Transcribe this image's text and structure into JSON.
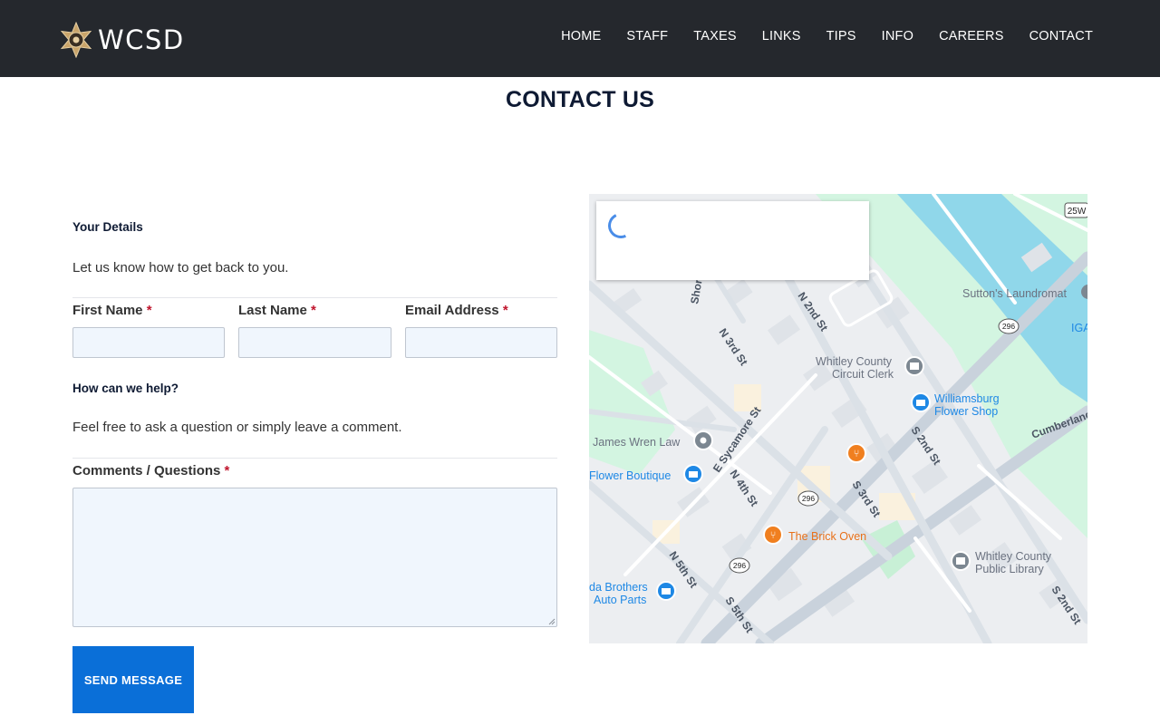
{
  "header": {
    "brand": "WCSD",
    "logo_icon": "sheriff-star-icon",
    "nav": [
      {
        "label": "HOME"
      },
      {
        "label": "STAFF"
      },
      {
        "label": "TAXES"
      },
      {
        "label": "LINKS"
      },
      {
        "label": "TIPS"
      },
      {
        "label": "INFO"
      },
      {
        "label": "CAREERS"
      },
      {
        "label": "CONTACT"
      }
    ]
  },
  "page": {
    "title": "CONTACT US"
  },
  "form": {
    "details_heading": "Your Details",
    "details_desc": "Let us know how to get back to you.",
    "first_name_label": "First Name",
    "last_name_label": "Last Name",
    "email_label": "Email Address",
    "required_mark": "*",
    "help_heading": "How can we help?",
    "help_desc": "Feel free to ask a question or simply leave a comment.",
    "comments_label": "Comments / Questions",
    "submit_label": "SEND MESSAGE"
  },
  "map": {
    "road_shields": [
      "25W",
      "296",
      "296",
      "296"
    ],
    "street_labels": [
      "N 2nd St",
      "N 3rd St",
      "E Sycamore St",
      "N 4th St",
      "S 3rd St",
      "S 2nd St",
      "N 5th St",
      "S 5th St",
      "S 2nd St",
      "Cumberland",
      "Shor"
    ],
    "places": [
      {
        "name": "Sutton's Laundromat"
      },
      {
        "name": "IGA"
      },
      {
        "name": "Whitley County",
        "name2": "Circuit Clerk"
      },
      {
        "name": "Williamsburg",
        "name2": "Flower Shop"
      },
      {
        "name": "James Wren Law"
      },
      {
        "name": "Flower Boutique"
      },
      {
        "name": "The Brick Oven"
      },
      {
        "name": "Whitley County",
        "name2": "Public Library"
      },
      {
        "name": "da Brothers",
        "name2": "Auto Parts"
      }
    ],
    "colors": {
      "water": "#90d7ea",
      "park": "#d3f5e1",
      "road": "#ffffff",
      "arterial": "#c9d2dc",
      "blue_pin": "#1e88e5",
      "orange_pin": "#f07f1f",
      "gray_pin": "#7c8791"
    }
  }
}
